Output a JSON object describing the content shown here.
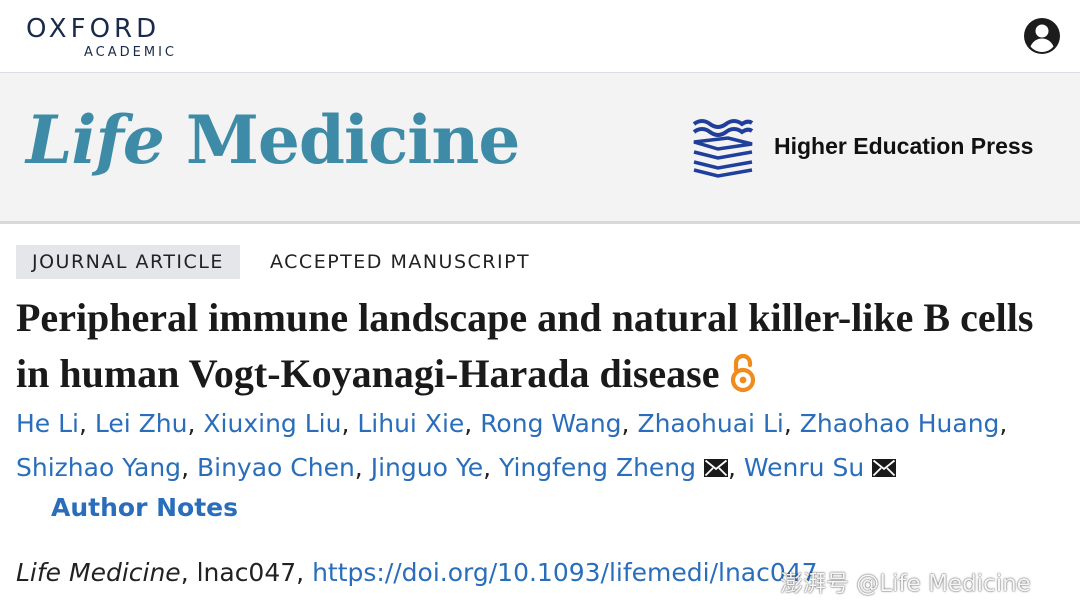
{
  "header": {
    "logo_top": "OXFORD",
    "logo_bottom": "ACADEMIC",
    "account_icon": "user-account-icon"
  },
  "banner": {
    "journal_title_part1": "Life",
    "journal_title_part2": " Medicine",
    "publisher": "Higher Education Press",
    "publisher_logo_icon": "hep-stacked-books-icon"
  },
  "article": {
    "type_badge": "JOURNAL ARTICLE",
    "status": "ACCEPTED MANUSCRIPT",
    "title": "Peripheral immune landscape and natural killer-like B cells in human Vogt-Koyanagi-Harada disease",
    "open_access_icon": "open-access-lock-icon",
    "authors": [
      {
        "name": "He Li",
        "sep": ", "
      },
      {
        "name": "Lei Zhu",
        "sep": ", "
      },
      {
        "name": "Xiuxing Liu",
        "sep": ", "
      },
      {
        "name": "Lihui Xie",
        "sep": ", "
      },
      {
        "name": "Rong Wang",
        "sep": ", "
      },
      {
        "name": "Zhaohuai Li",
        "sep": ", "
      },
      {
        "name": "Zhaohao Huang",
        "sep": ","
      },
      {
        "name": "Shizhao Yang",
        "sep": ", "
      },
      {
        "name": "Binyao Chen",
        "sep": ", "
      },
      {
        "name": "Jinguo Ye",
        "sep": ", "
      },
      {
        "name": "Yingfeng Zheng",
        "sep": ", ",
        "mail": true
      },
      {
        "name": "Wenru Su",
        "sep": "",
        "mail": true
      }
    ],
    "author_notes_label": "Author Notes",
    "mail_icon": "envelope-icon",
    "citation_journal": "Life Medicine",
    "citation_id": ", lnac047, ",
    "doi": "https://doi.org/10.1093/lifemedi/lnac047"
  },
  "watermark": "澎湃号 @Life Medicine",
  "colors": {
    "accent_blue": "#2a6ebb",
    "journal_teal": "#3d8ba6",
    "navy": "#1a2b4a",
    "open_access_orange": "#f08c1e"
  }
}
